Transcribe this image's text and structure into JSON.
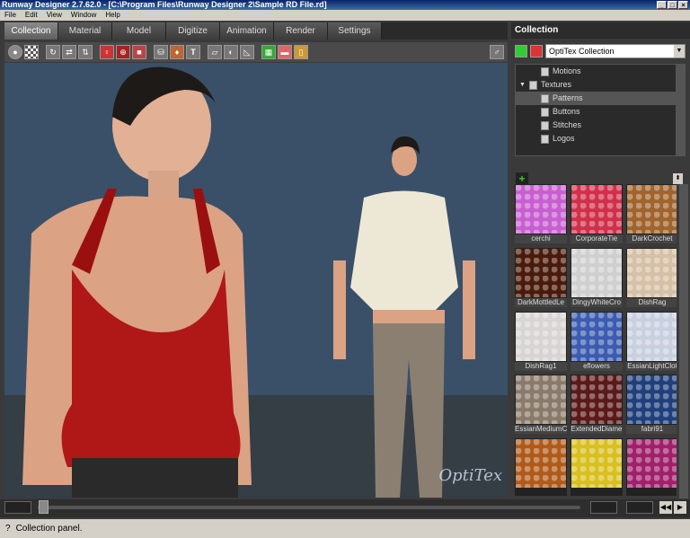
{
  "window": {
    "title": "Runway Designer 2.7.62.0 - [C:\\Program Files\\Runway Designer 2\\Sample RD File.rd]"
  },
  "menu": [
    "File",
    "Edit",
    "View",
    "Window",
    "Help"
  ],
  "tabs": [
    "Collection",
    "Material",
    "Model",
    "Digitize",
    "Animation",
    "Render",
    "Settings"
  ],
  "active_tab": "Collection",
  "toolbar": {
    "icons": [
      "sphere-icon",
      "checker-icon",
      "rotate-icon",
      "move-icon",
      "move-vertical-icon",
      "model-icon",
      "target-icon",
      "camera-icon",
      "bucket-icon",
      "fill-icon",
      "text-icon",
      "fabric-icon",
      "iron-icon",
      "triangle-icon",
      "grid-icon",
      "grid2-icon",
      "page-icon",
      "person-icon"
    ],
    "text_tool": "T"
  },
  "viewport": {
    "logo": "OptiTex"
  },
  "statusbar": {
    "help": "?",
    "text": "Collection panel."
  },
  "collection": {
    "title": "Collection",
    "dropdown": "OptiTex Collection",
    "tree": [
      {
        "label": "Motions",
        "indent": 2
      },
      {
        "label": "Textures",
        "indent": 0,
        "expand": "▼"
      },
      {
        "label": "Patterns",
        "indent": 2,
        "selected": true
      },
      {
        "label": "Buttons",
        "indent": 2
      },
      {
        "label": "Stitches",
        "indent": 2
      },
      {
        "label": "Logos",
        "indent": 2
      }
    ],
    "add": "+",
    "sort": "⬍",
    "items": [
      {
        "label": "cerchi",
        "color": "#c85fd0"
      },
      {
        "label": "CorporateTie",
        "color": "#d0304a"
      },
      {
        "label": "DarkCrochet",
        "color": "#a0642c"
      },
      {
        "label": "DarkMottledLe",
        "color": "#4a1a0a"
      },
      {
        "label": "DingyWhiteCro",
        "color": "#cfcfcf"
      },
      {
        "label": "DishRag",
        "color": "#d6c0a6"
      },
      {
        "label": "DishRag1",
        "color": "#d8d4d4"
      },
      {
        "label": "eflowers",
        "color": "#3c5cb0"
      },
      {
        "label": "EssianLightClot",
        "color": "#c8d0e0"
      },
      {
        "label": "EssianMediumC",
        "color": "#8a7a6a"
      },
      {
        "label": "ExtendedDiame",
        "color": "#5a1a1a"
      },
      {
        "label": "fabri91",
        "color": "#20407c"
      },
      {
        "label": "",
        "color": "#b05a1a"
      },
      {
        "label": "",
        "color": "#d8c020"
      },
      {
        "label": "",
        "color": "#a0206a"
      }
    ]
  },
  "colors": {
    "accent_green": "#33cc33",
    "accent_red": "#dd3333"
  }
}
